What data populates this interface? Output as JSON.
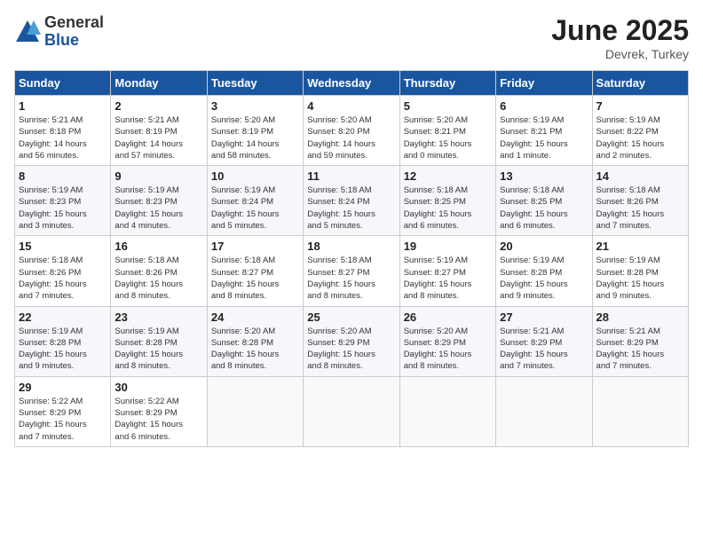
{
  "logo": {
    "general": "General",
    "blue": "Blue"
  },
  "title": "June 2025",
  "location": "Devrek, Turkey",
  "days_of_week": [
    "Sunday",
    "Monday",
    "Tuesday",
    "Wednesday",
    "Thursday",
    "Friday",
    "Saturday"
  ],
  "weeks": [
    [
      {
        "day": "1",
        "info": "Sunrise: 5:21 AM\nSunset: 8:18 PM\nDaylight: 14 hours\nand 56 minutes."
      },
      {
        "day": "2",
        "info": "Sunrise: 5:21 AM\nSunset: 8:19 PM\nDaylight: 14 hours\nand 57 minutes."
      },
      {
        "day": "3",
        "info": "Sunrise: 5:20 AM\nSunset: 8:19 PM\nDaylight: 14 hours\nand 58 minutes."
      },
      {
        "day": "4",
        "info": "Sunrise: 5:20 AM\nSunset: 8:20 PM\nDaylight: 14 hours\nand 59 minutes."
      },
      {
        "day": "5",
        "info": "Sunrise: 5:20 AM\nSunset: 8:21 PM\nDaylight: 15 hours\nand 0 minutes."
      },
      {
        "day": "6",
        "info": "Sunrise: 5:19 AM\nSunset: 8:21 PM\nDaylight: 15 hours\nand 1 minute."
      },
      {
        "day": "7",
        "info": "Sunrise: 5:19 AM\nSunset: 8:22 PM\nDaylight: 15 hours\nand 2 minutes."
      }
    ],
    [
      {
        "day": "8",
        "info": "Sunrise: 5:19 AM\nSunset: 8:23 PM\nDaylight: 15 hours\nand 3 minutes."
      },
      {
        "day": "9",
        "info": "Sunrise: 5:19 AM\nSunset: 8:23 PM\nDaylight: 15 hours\nand 4 minutes."
      },
      {
        "day": "10",
        "info": "Sunrise: 5:19 AM\nSunset: 8:24 PM\nDaylight: 15 hours\nand 5 minutes."
      },
      {
        "day": "11",
        "info": "Sunrise: 5:18 AM\nSunset: 8:24 PM\nDaylight: 15 hours\nand 5 minutes."
      },
      {
        "day": "12",
        "info": "Sunrise: 5:18 AM\nSunset: 8:25 PM\nDaylight: 15 hours\nand 6 minutes."
      },
      {
        "day": "13",
        "info": "Sunrise: 5:18 AM\nSunset: 8:25 PM\nDaylight: 15 hours\nand 6 minutes."
      },
      {
        "day": "14",
        "info": "Sunrise: 5:18 AM\nSunset: 8:26 PM\nDaylight: 15 hours\nand 7 minutes."
      }
    ],
    [
      {
        "day": "15",
        "info": "Sunrise: 5:18 AM\nSunset: 8:26 PM\nDaylight: 15 hours\nand 7 minutes."
      },
      {
        "day": "16",
        "info": "Sunrise: 5:18 AM\nSunset: 8:26 PM\nDaylight: 15 hours\nand 8 minutes."
      },
      {
        "day": "17",
        "info": "Sunrise: 5:18 AM\nSunset: 8:27 PM\nDaylight: 15 hours\nand 8 minutes."
      },
      {
        "day": "18",
        "info": "Sunrise: 5:18 AM\nSunset: 8:27 PM\nDaylight: 15 hours\nand 8 minutes."
      },
      {
        "day": "19",
        "info": "Sunrise: 5:19 AM\nSunset: 8:27 PM\nDaylight: 15 hours\nand 8 minutes."
      },
      {
        "day": "20",
        "info": "Sunrise: 5:19 AM\nSunset: 8:28 PM\nDaylight: 15 hours\nand 9 minutes."
      },
      {
        "day": "21",
        "info": "Sunrise: 5:19 AM\nSunset: 8:28 PM\nDaylight: 15 hours\nand 9 minutes."
      }
    ],
    [
      {
        "day": "22",
        "info": "Sunrise: 5:19 AM\nSunset: 8:28 PM\nDaylight: 15 hours\nand 9 minutes."
      },
      {
        "day": "23",
        "info": "Sunrise: 5:19 AM\nSunset: 8:28 PM\nDaylight: 15 hours\nand 8 minutes."
      },
      {
        "day": "24",
        "info": "Sunrise: 5:20 AM\nSunset: 8:28 PM\nDaylight: 15 hours\nand 8 minutes."
      },
      {
        "day": "25",
        "info": "Sunrise: 5:20 AM\nSunset: 8:29 PM\nDaylight: 15 hours\nand 8 minutes."
      },
      {
        "day": "26",
        "info": "Sunrise: 5:20 AM\nSunset: 8:29 PM\nDaylight: 15 hours\nand 8 minutes."
      },
      {
        "day": "27",
        "info": "Sunrise: 5:21 AM\nSunset: 8:29 PM\nDaylight: 15 hours\nand 7 minutes."
      },
      {
        "day": "28",
        "info": "Sunrise: 5:21 AM\nSunset: 8:29 PM\nDaylight: 15 hours\nand 7 minutes."
      }
    ],
    [
      {
        "day": "29",
        "info": "Sunrise: 5:22 AM\nSunset: 8:29 PM\nDaylight: 15 hours\nand 7 minutes."
      },
      {
        "day": "30",
        "info": "Sunrise: 5:22 AM\nSunset: 8:29 PM\nDaylight: 15 hours\nand 6 minutes."
      },
      {
        "day": "",
        "info": ""
      },
      {
        "day": "",
        "info": ""
      },
      {
        "day": "",
        "info": ""
      },
      {
        "day": "",
        "info": ""
      },
      {
        "day": "",
        "info": ""
      }
    ]
  ]
}
